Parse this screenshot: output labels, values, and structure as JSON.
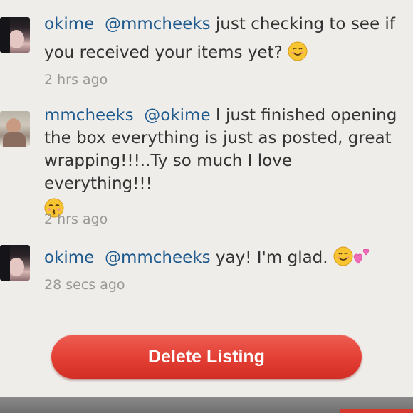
{
  "comments": [
    {
      "avatar": "okime-avatar",
      "username": "okime",
      "mention": "@mmcheeks",
      "text": "just checking to see if you received your items yet?",
      "emoji": "smiling-face-emoji",
      "time": "2 hrs ago"
    },
    {
      "avatar": "mmcheeks-avatar",
      "username": "mmcheeks",
      "mention": "@okime",
      "text": "I just finished opening the box everything is just as posted, great wrapping!!!..Ty so much I love everything!!!",
      "emoji": "kissing-face-emoji",
      "time": "2 hrs ago"
    },
    {
      "avatar": "okime-avatar",
      "username": "okime",
      "mention": "@mmcheeks",
      "text": "yay! I'm glad.",
      "emoji": "smiling-face-and-hearts-emoji",
      "time": "28 secs ago"
    }
  ],
  "actions": {
    "delete_label": "Delete Listing"
  },
  "colors": {
    "username": "#1e5a8e",
    "delete_button": "#e33e33",
    "background": "#efedea"
  }
}
